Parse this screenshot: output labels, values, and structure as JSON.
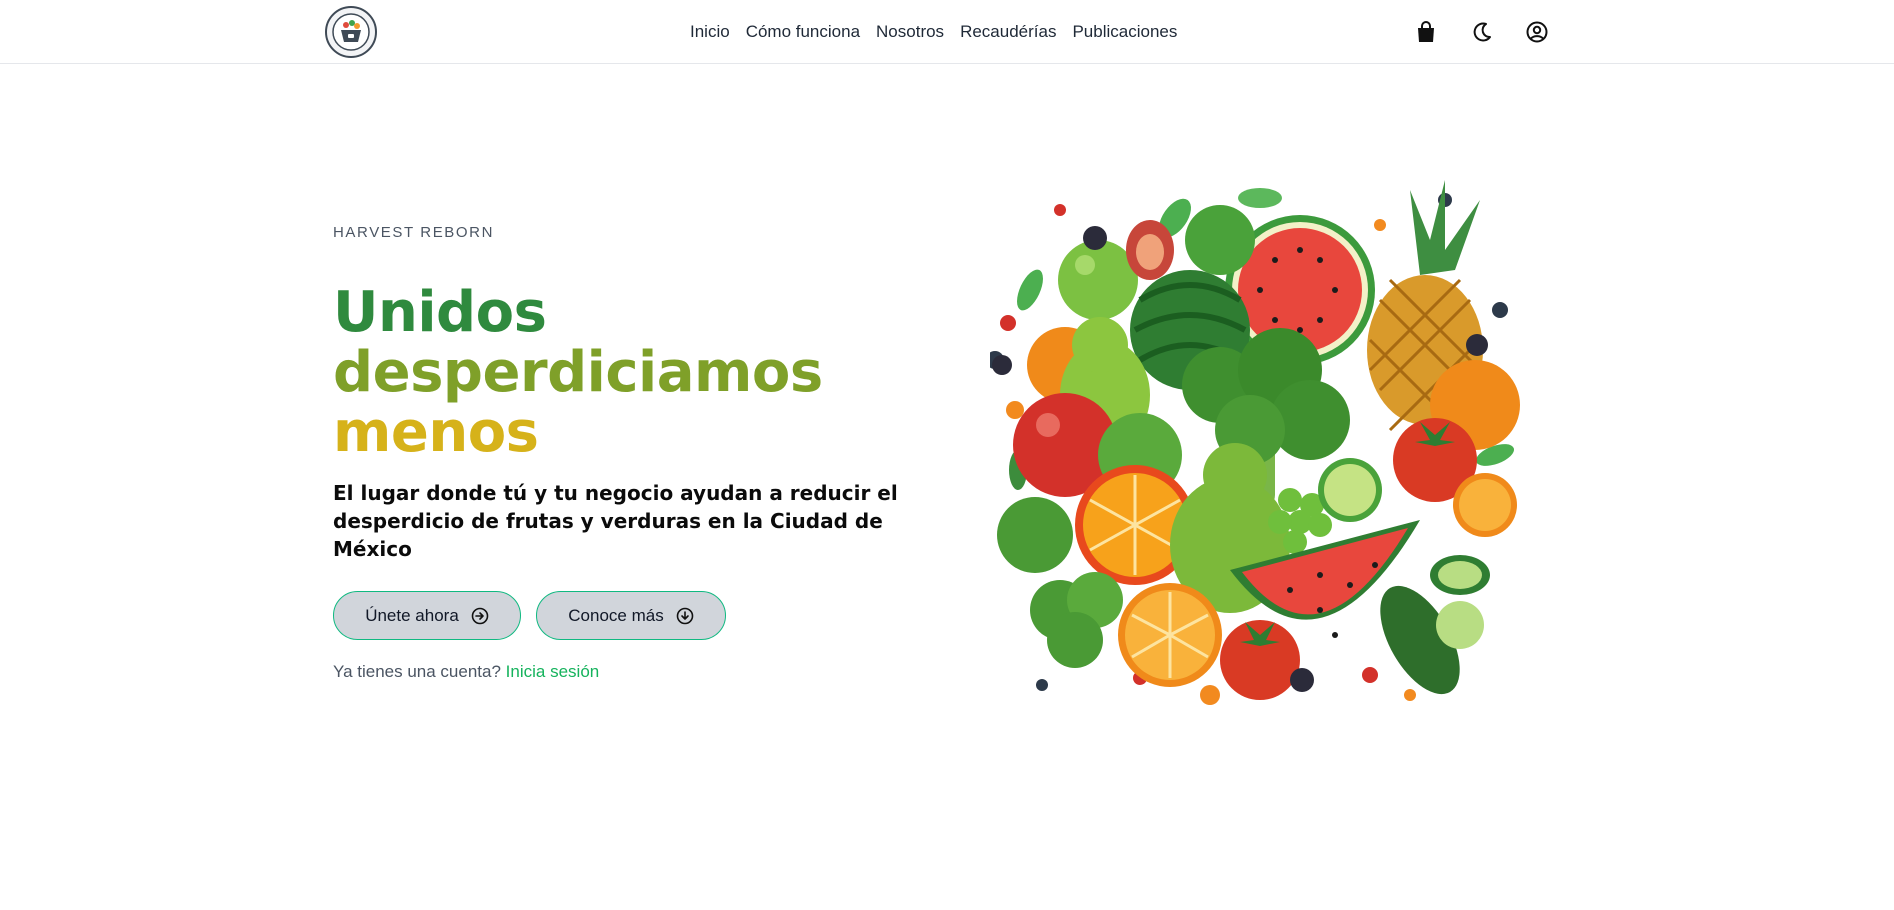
{
  "nav": {
    "links": [
      "Inicio",
      "Cómo funciona",
      "Nosotros",
      "Recaudérías",
      "Publicaciones"
    ],
    "icons": [
      "shopping-bag-icon",
      "moon-icon",
      "user-circle-icon"
    ]
  },
  "hero": {
    "eyebrow": "HARVEST REBORN",
    "headline": [
      "Unidos",
      "desperdiciamos",
      "menos"
    ],
    "subtitle": "El lugar donde tú y tu negocio ayudan a reducir el desperdicio de frutas y verduras en la Ciudad de México",
    "buttons": {
      "join": "Únete ahora",
      "more": "Conoce más"
    },
    "signin": {
      "prompt": "Ya tienes una cuenta?",
      "link": "Inicia sesión"
    }
  },
  "colors": {
    "headline_line1": "#2f8a3e",
    "headline_line2": "#7fa029",
    "headline_line3": "#d6b21a",
    "accent_border": "#10b981",
    "link": "#16b35d",
    "button_bg": "#d1d5db"
  }
}
